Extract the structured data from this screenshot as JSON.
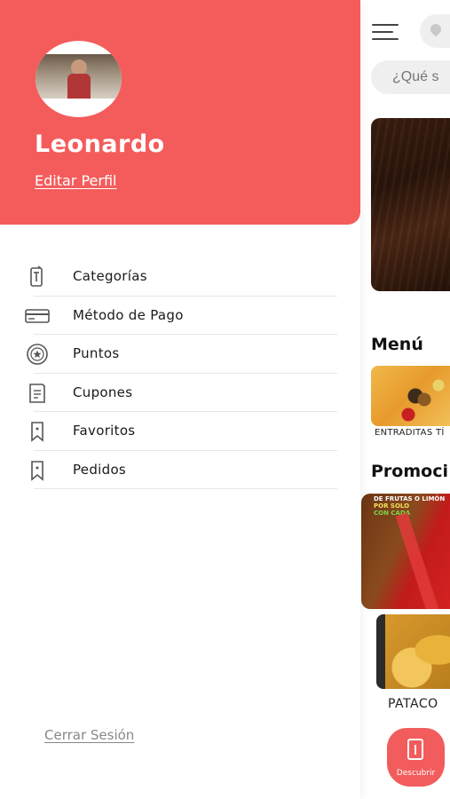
{
  "colors": {
    "accent": "#f45c5c",
    "text": "#1a1a1a",
    "muted": "#888888",
    "divider": "#e6e6e6"
  },
  "drawer": {
    "user_name": "Leonardo",
    "edit_profile": "Editar Perfil",
    "items": [
      {
        "label": "Categorías",
        "icon": "category-icon"
      },
      {
        "label": "Método de Pago",
        "icon": "credit-card-icon"
      },
      {
        "label": "Puntos",
        "icon": "star-badge-icon"
      },
      {
        "label": "Cupones",
        "icon": "coupon-icon"
      },
      {
        "label": "Favoritos",
        "icon": "bookmark-icon"
      },
      {
        "label": "Pedidos",
        "icon": "bookmark-icon"
      }
    ],
    "logout": "Cerrar Sesión"
  },
  "background": {
    "search_placeholder": "¿Qué s",
    "menu_title": "Menú",
    "menu_card_label": "ENTRADITAS TÍ",
    "promo_title": "Promoci",
    "promo_text": [
      "DE FRUTAS O LIMÓN",
      "POR SOLO",
      "CON CADA"
    ],
    "pataco_label": "PATACO",
    "fab_label": "Descubrir"
  }
}
